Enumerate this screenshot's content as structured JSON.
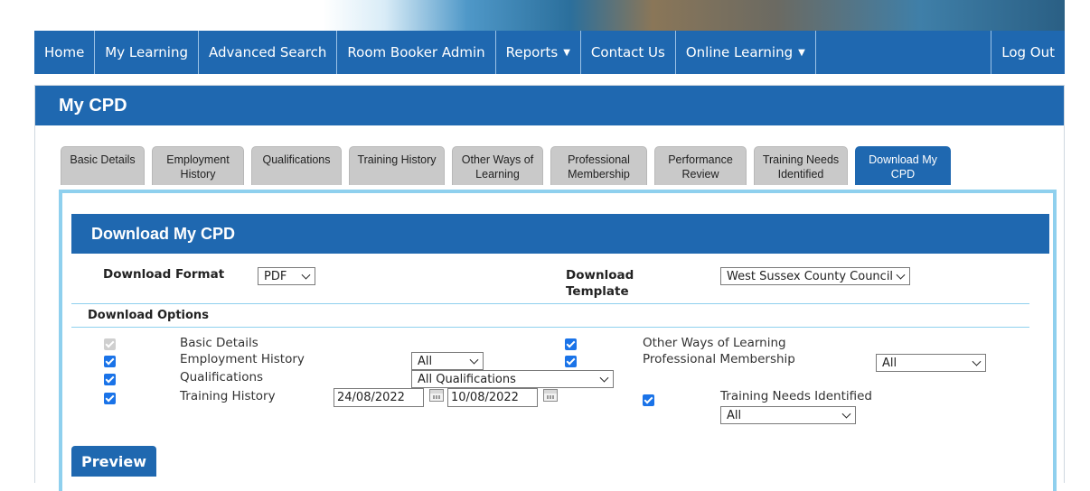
{
  "nav": {
    "home": "Home",
    "my_learning": "My Learning",
    "advanced_search": "Advanced Search",
    "room_booker": "Room Booker Admin",
    "reports": "Reports",
    "contact": "Contact Us",
    "online_learning": "Online Learning",
    "logout": "Log Out"
  },
  "page": {
    "title": "My CPD"
  },
  "tabs": [
    {
      "label": "Basic Details"
    },
    {
      "label": "Employment History"
    },
    {
      "label": "Qualifications"
    },
    {
      "label": "Training History"
    },
    {
      "label": "Other Ways of Learning"
    },
    {
      "label": "Professional Membership"
    },
    {
      "label": "Performance Review"
    },
    {
      "label": "Training Needs Identified"
    },
    {
      "label": "Download My CPD"
    }
  ],
  "download": {
    "title": "Download My CPD",
    "format_label": "Download Format",
    "format_value": "PDF",
    "template_label": "Download Template",
    "template_value": "West Sussex County Council",
    "options_label": "Download Options",
    "options": {
      "basic_details": "Basic Details",
      "employment_history": "Employment History",
      "employment_filter": "All",
      "qualifications": "Qualifications",
      "qualifications_filter": "All Qualifications",
      "training_history": "Training History",
      "date_from": "24/08/2022",
      "date_to": "10/08/2022",
      "other_ways": "Other Ways of Learning",
      "professional_membership": "Professional Membership",
      "membership_filter": "All",
      "training_needs": "Training Needs Identified",
      "training_needs_filter": "All"
    },
    "preview_button": "Preview"
  },
  "colors": {
    "primary": "#1f68b0",
    "accent_border": "#8fd0ee",
    "checkbox": "#1a73e8"
  }
}
